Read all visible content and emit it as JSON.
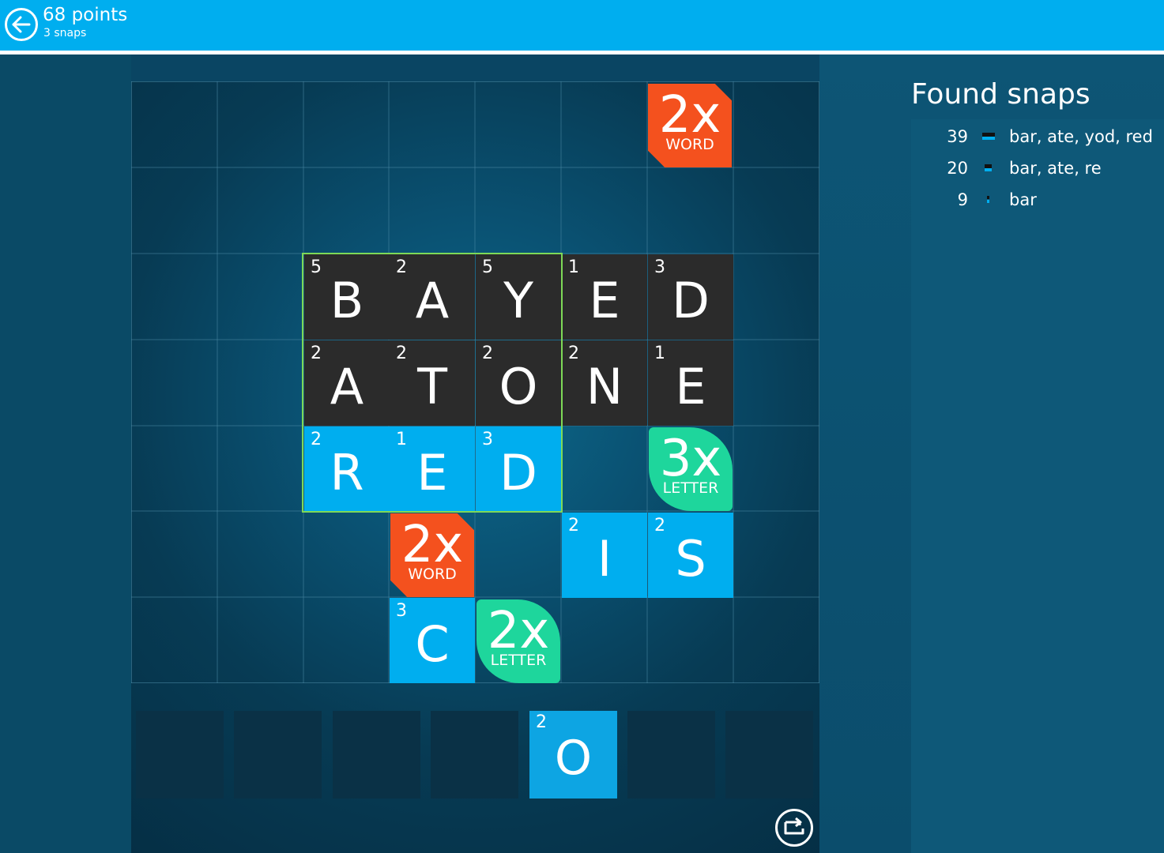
{
  "header": {
    "points": "68 points",
    "snaps": "3 snaps"
  },
  "board": {
    "tiles": [
      {
        "letter": "B",
        "value": "5",
        "style": "dark"
      },
      {
        "letter": "A",
        "value": "2",
        "style": "dark"
      },
      {
        "letter": "Y",
        "value": "5",
        "style": "dark"
      },
      {
        "letter": "E",
        "value": "1",
        "style": "dark"
      },
      {
        "letter": "D",
        "value": "3",
        "style": "dark"
      },
      {
        "letter": "A",
        "value": "2",
        "style": "dark"
      },
      {
        "letter": "T",
        "value": "2",
        "style": "dark"
      },
      {
        "letter": "O",
        "value": "2",
        "style": "dark"
      },
      {
        "letter": "N",
        "value": "2",
        "style": "dark"
      },
      {
        "letter": "E",
        "value": "1",
        "style": "dark"
      },
      {
        "letter": "R",
        "value": "2",
        "style": "blue"
      },
      {
        "letter": "E",
        "value": "1",
        "style": "blue"
      },
      {
        "letter": "D",
        "value": "3",
        "style": "blue"
      },
      {
        "letter": "I",
        "value": "2",
        "style": "blue"
      },
      {
        "letter": "S",
        "value": "2",
        "style": "blue"
      },
      {
        "letter": "C",
        "value": "3",
        "style": "blue"
      }
    ],
    "bonuses": [
      {
        "mult": "2x",
        "kind": "WORD",
        "type": "word"
      },
      {
        "mult": "3x",
        "kind": "LETTER",
        "type": "letter"
      },
      {
        "mult": "2x",
        "kind": "WORD",
        "type": "word"
      },
      {
        "mult": "2x",
        "kind": "LETTER",
        "type": "letter"
      }
    ]
  },
  "rack": {
    "tile": {
      "letter": "O",
      "value": "2"
    }
  },
  "found_snaps": {
    "title": "Found snaps",
    "items": [
      {
        "points": "39",
        "words": "bar, ate, yod, red"
      },
      {
        "points": "20",
        "words": "bar, ate, re"
      },
      {
        "points": "9",
        "words": "bar"
      }
    ]
  },
  "colors": {
    "header": "#00aeef",
    "tile_dark": "#2b2b2b",
    "tile_blue": "#00aeef",
    "bonus_word": "#f4511e",
    "bonus_letter": "#1ed69c",
    "snap_outline": "#7ed957"
  },
  "icons": {
    "back": "back-arrow-icon",
    "shuffle": "shuffle-icon"
  }
}
